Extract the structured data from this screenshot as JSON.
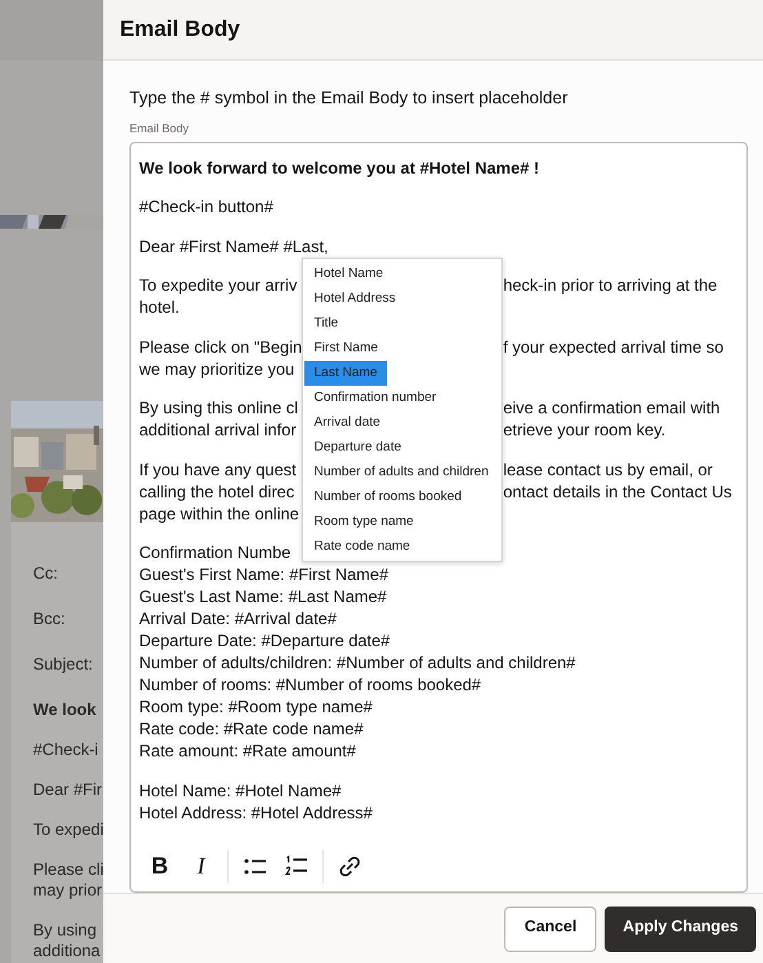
{
  "background": {
    "fields": [
      {
        "label": "Cc:"
      },
      {
        "label": "Bcc:"
      },
      {
        "label": "Subject:"
      }
    ],
    "paragraphs": [
      {
        "bold": true,
        "lines": [
          "We look"
        ]
      },
      {
        "bold": false,
        "lines": [
          "#Check-i"
        ]
      },
      {
        "bold": false,
        "lines": [
          "Dear #Fir"
        ]
      },
      {
        "bold": false,
        "lines": [
          "To expedi"
        ]
      },
      {
        "bold": false,
        "lines": [
          "Please cli",
          "may prior"
        ]
      },
      {
        "bold": false,
        "lines": [
          "By using",
          "additiona"
        ]
      }
    ]
  },
  "drawer": {
    "title": "Email Body",
    "hint": "Type the # symbol in the Email Body to insert placeholder",
    "field_label": "Email Body",
    "editor": {
      "paragraphs": [
        {
          "bold": true,
          "lines": [
            {
              "left": "We look forward to welcome you at #Hotel Name# !"
            }
          ]
        },
        {
          "bold": false,
          "lines": [
            {
              "left": "#Check-in button#"
            }
          ]
        },
        {
          "bold": false,
          "lines": [
            {
              "left": "Dear #First Name# #Last,"
            }
          ]
        },
        {
          "bold": false,
          "lines": [
            {
              "left": "To expedite your arriv",
              "right": "heck-in prior to arriving at the"
            },
            {
              "left": "hotel."
            }
          ]
        },
        {
          "bold": false,
          "lines": [
            {
              "left": "Please click on \"Begin",
              "right": "f your expected arrival time so"
            },
            {
              "left": "we may prioritize you"
            }
          ]
        },
        {
          "bold": false,
          "lines": [
            {
              "left": "By using this online cl",
              "right": "eive a confirmation email with"
            },
            {
              "left": "additional arrival infor",
              "right": "etrieve your room key."
            }
          ]
        },
        {
          "bold": false,
          "lines": [
            {
              "left": "If you have any quest",
              "right": "lease contact us by email, or"
            },
            {
              "left": "calling the hotel direc",
              "right": "ontact details in the Contact Us"
            },
            {
              "left": "page within the online"
            }
          ]
        },
        {
          "bold": false,
          "lines": [
            {
              "left": "Confirmation Numbe"
            },
            {
              "left": "Guest's First Name: #First Name#"
            },
            {
              "left": "Guest's Last Name: #Last Name#"
            },
            {
              "left": "Arrival Date: #Arrival date#"
            },
            {
              "left": "Departure Date: #Departure date#"
            },
            {
              "left": "Number of adults/children: #Number of adults and children#"
            },
            {
              "left": "Number of rooms: #Number of rooms booked#"
            },
            {
              "left": "Room type: #Room type name#"
            },
            {
              "left": "Rate code: #Rate code name#"
            },
            {
              "left": "Rate amount: #Rate amount#"
            }
          ]
        },
        {
          "bold": false,
          "lines": [
            {
              "left": "Hotel Name: #Hotel Name#"
            },
            {
              "left": "Hotel Address: #Hotel Address#"
            }
          ]
        }
      ]
    },
    "placeholder_menu": {
      "items": [
        {
          "label": "Hotel Name",
          "selected": false
        },
        {
          "label": "Hotel Address",
          "selected": false
        },
        {
          "label": "Title",
          "selected": false
        },
        {
          "label": "First Name",
          "selected": false
        },
        {
          "label": "Last Name",
          "selected": true
        },
        {
          "label": "Confirmation number",
          "selected": false
        },
        {
          "label": "Arrival date",
          "selected": false
        },
        {
          "label": "Departure date",
          "selected": false
        },
        {
          "label": "Number of adults and children",
          "selected": false
        },
        {
          "label": "Number of rooms booked",
          "selected": false
        },
        {
          "label": "Room type name",
          "selected": false
        },
        {
          "label": "Rate code name",
          "selected": false
        }
      ]
    },
    "toolbar": [
      {
        "kind": "bold",
        "label": "B"
      },
      {
        "kind": "italic",
        "label": "I"
      },
      {
        "kind": "separator"
      },
      {
        "kind": "bullets"
      },
      {
        "kind": "numbered"
      },
      {
        "kind": "separator"
      },
      {
        "kind": "link"
      }
    ],
    "buttons": [
      {
        "label": "Cancel",
        "kind": "secondary"
      },
      {
        "label": "Apply Changes",
        "kind": "primary"
      }
    ]
  }
}
